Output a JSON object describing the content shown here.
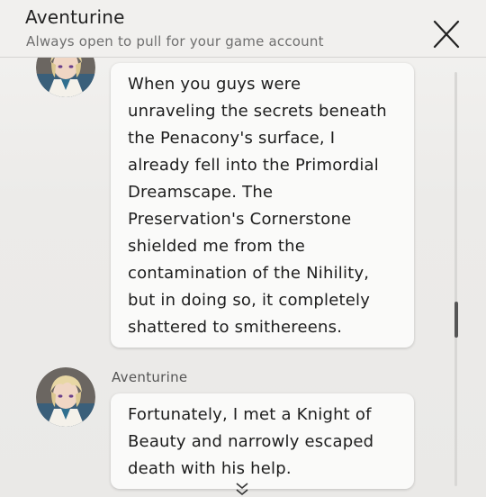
{
  "header": {
    "contact_name": "Aventurine",
    "signature": "Always open to pull for your game account",
    "close_icon": "close-icon"
  },
  "messages": [
    {
      "sender": "Aventurine",
      "show_sender_label": false,
      "avatar_icon": "avatar-aventurine",
      "text": "When you guys were\nunraveling the secrets beneath\nthe Penacony's surface, I\nalready fell into the Primordial\nDreamscape. The\nPreservation's Cornerstone\nshielded me from the\ncontamination of the Nihility,\nbut in doing so, it completely\nshattered to smithereens."
    },
    {
      "sender": "Aventurine",
      "show_sender_label": true,
      "avatar_icon": "avatar-aventurine",
      "text": "Fortunately, I met a Knight of\nBeauty and narrowly escaped\ndeath with his help."
    }
  ],
  "scroll_indicator_icon": "chevron-double-down-icon",
  "colors": {
    "background": "#eceae8",
    "bubble": "#fafaf9",
    "text": "#1d1d1d",
    "subtext": "#6f6f6f"
  }
}
